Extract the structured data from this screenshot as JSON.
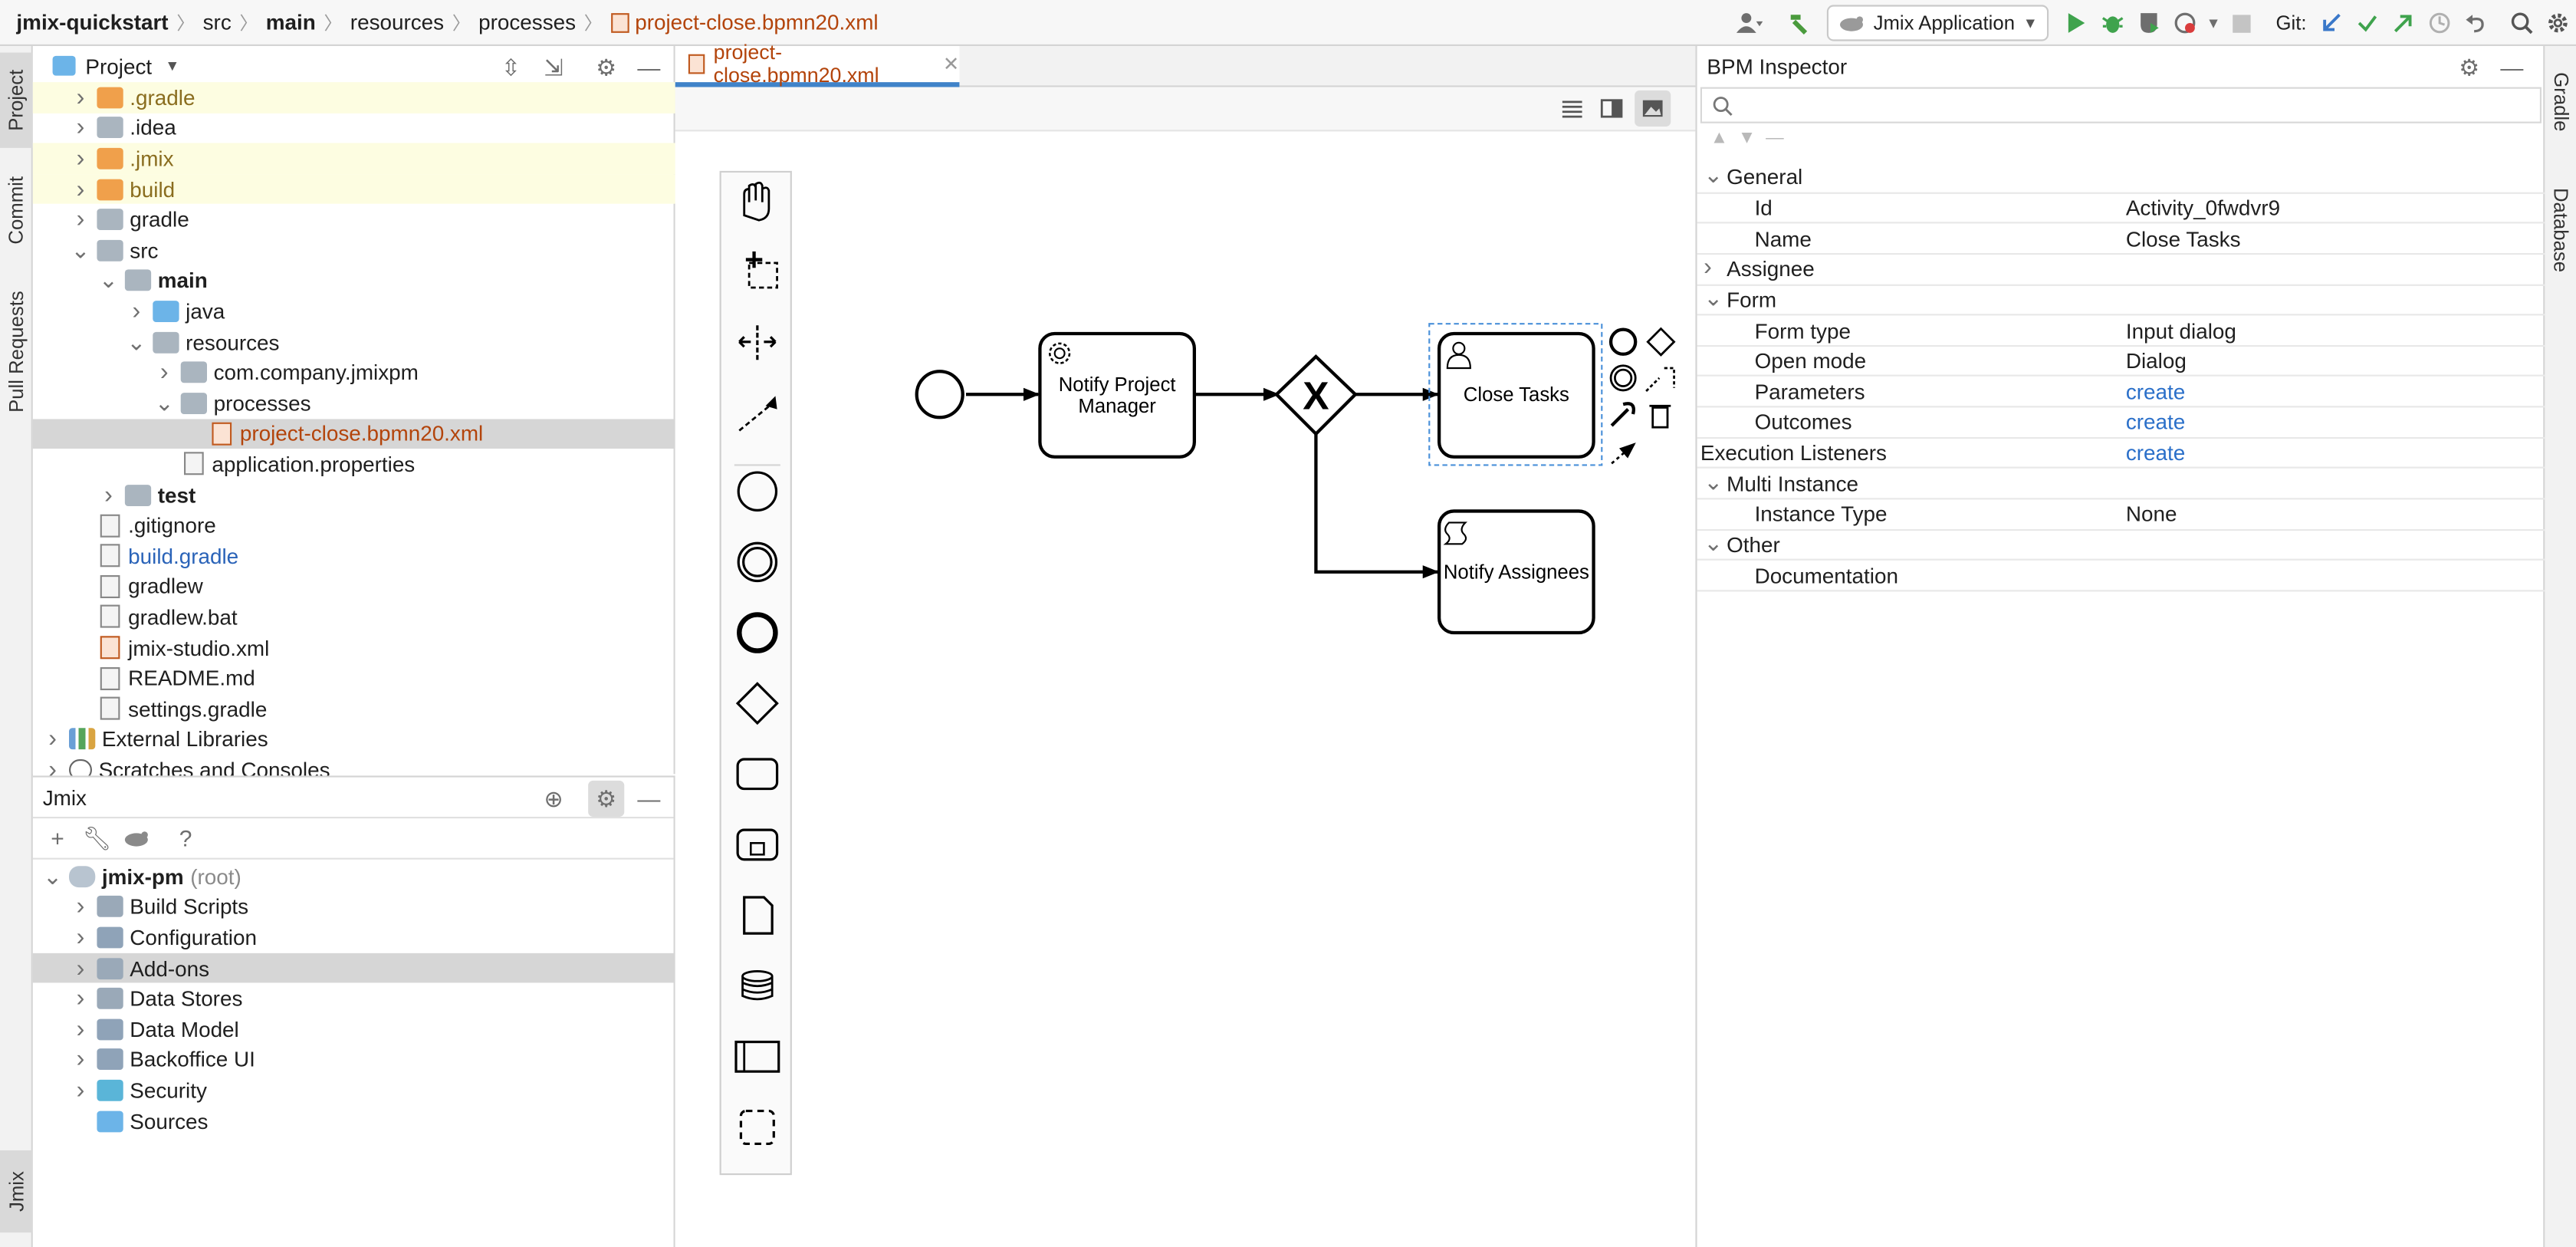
{
  "breadcrumb": {
    "project": "jmix-quickstart",
    "parts": [
      "src",
      "main",
      "resources",
      "processes"
    ],
    "file": "project-close.bpmn20.xml"
  },
  "toolbar": {
    "run_config": "Jmix Application",
    "git_label": "Git:"
  },
  "left_stripe": {
    "project": "Project",
    "commit": "Commit",
    "pull_requests": "Pull Requests",
    "jmix": "Jmix"
  },
  "right_stripe": {
    "gradle": "Gradle",
    "database": "Database"
  },
  "project_panel": {
    "title": "Project",
    "tree": [
      {
        "label": ".gradle",
        "depth": 1,
        "expand": ">",
        "icon": "folder-orange",
        "style": "hl"
      },
      {
        "label": ".idea",
        "depth": 1,
        "expand": ">",
        "icon": "folder",
        "style": ""
      },
      {
        "label": ".jmix",
        "depth": 1,
        "expand": ">",
        "icon": "folder-orange",
        "style": "hl"
      },
      {
        "label": "build",
        "depth": 1,
        "expand": ">",
        "icon": "folder-orange",
        "style": "hl"
      },
      {
        "label": "gradle",
        "depth": 1,
        "expand": ">",
        "icon": "folder",
        "style": ""
      },
      {
        "label": "src",
        "depth": 1,
        "expand": "v",
        "icon": "folder",
        "style": ""
      },
      {
        "label": "main",
        "depth": 2,
        "expand": "v",
        "icon": "folder",
        "style": "bold"
      },
      {
        "label": "java",
        "depth": 3,
        "expand": ">",
        "icon": "folder-blue",
        "style": ""
      },
      {
        "label": "resources",
        "depth": 3,
        "expand": "v",
        "icon": "folder",
        "style": ""
      },
      {
        "label": "com.company.jmixpm",
        "depth": 4,
        "expand": ">",
        "icon": "folder",
        "style": ""
      },
      {
        "label": "processes",
        "depth": 4,
        "expand": "v",
        "icon": "folder",
        "style": ""
      },
      {
        "label": "project-close.bpmn20.xml",
        "depth": 5,
        "expand": "",
        "icon": "file",
        "style": "sel"
      },
      {
        "label": "application.properties",
        "depth": 4,
        "expand": "",
        "icon": "file",
        "style": ""
      },
      {
        "label": "test",
        "depth": 2,
        "expand": ">",
        "icon": "folder",
        "style": "bold"
      },
      {
        "label": ".gitignore",
        "depth": 1,
        "expand": "",
        "icon": "file",
        "style": ""
      },
      {
        "label": "build.gradle",
        "depth": 1,
        "expand": "",
        "icon": "file",
        "style": "blue"
      },
      {
        "label": "gradlew",
        "depth": 1,
        "expand": "",
        "icon": "file",
        "style": ""
      },
      {
        "label": "gradlew.bat",
        "depth": 1,
        "expand": "",
        "icon": "file",
        "style": ""
      },
      {
        "label": "jmix-studio.xml",
        "depth": 1,
        "expand": "",
        "icon": "file",
        "style": ""
      },
      {
        "label": "README.md",
        "depth": 1,
        "expand": "",
        "icon": "file",
        "style": ""
      },
      {
        "label": "settings.gradle",
        "depth": 1,
        "expand": "",
        "icon": "file",
        "style": ""
      },
      {
        "label": "External Libraries",
        "depth": 0,
        "expand": ">",
        "icon": "library",
        "style": ""
      },
      {
        "label": "Scratches and Consoles",
        "depth": 0,
        "expand": ">",
        "icon": "scratch",
        "style": ""
      }
    ]
  },
  "jmix_panel": {
    "title": "Jmix",
    "root_name": "jmix-pm",
    "root_suffix": "(root)",
    "items": [
      {
        "label": "Build Scripts",
        "style": ""
      },
      {
        "label": "Configuration",
        "style": ""
      },
      {
        "label": "Add-ons",
        "style": "sel"
      },
      {
        "label": "Data Stores",
        "style": ""
      },
      {
        "label": "Data Model",
        "style": ""
      },
      {
        "label": "Backoffice UI",
        "style": ""
      },
      {
        "label": "Security",
        "style": ""
      },
      {
        "label": "Sources",
        "style": "noarrow"
      }
    ]
  },
  "editor": {
    "tab_label": "project-close.bpmn20.xml",
    "diagram": {
      "tasks": [
        {
          "label_1": "Notify Project",
          "label_2": "Manager",
          "kind": "service"
        },
        {
          "label_1": "Close Tasks",
          "label_2": "",
          "kind": "user"
        },
        {
          "label_1": "Notify Assignees",
          "label_2": "",
          "kind": "script"
        }
      ],
      "gateway_symbol": "X"
    }
  },
  "inspector": {
    "title": "BPM Inspector",
    "rows": [
      {
        "type": "group",
        "expand": "v",
        "key": "General",
        "value": ""
      },
      {
        "type": "prop",
        "expand": "",
        "key": "Id",
        "value": "Activity_0fwdvr9"
      },
      {
        "type": "prop",
        "expand": "",
        "key": "Name",
        "value": "Close Tasks"
      },
      {
        "type": "group",
        "expand": ">",
        "key": "Assignee",
        "value": ""
      },
      {
        "type": "group",
        "expand": "v",
        "key": "Form",
        "value": ""
      },
      {
        "type": "prop",
        "expand": "",
        "key": "Form type",
        "value": "Input dialog"
      },
      {
        "type": "prop",
        "expand": "",
        "key": "Open mode",
        "value": "Dialog"
      },
      {
        "type": "prop",
        "expand": "",
        "key": "Parameters",
        "value": "create",
        "link": true
      },
      {
        "type": "prop",
        "expand": "",
        "key": "Outcomes",
        "value": "create",
        "link": true
      },
      {
        "type": "top",
        "expand": "",
        "key": "Execution Listeners",
        "value": "create",
        "link": true
      },
      {
        "type": "group",
        "expand": "v",
        "key": "Multi Instance",
        "value": ""
      },
      {
        "type": "prop",
        "expand": "",
        "key": "Instance Type",
        "value": "None"
      },
      {
        "type": "group",
        "expand": "v",
        "key": "Other",
        "value": ""
      },
      {
        "type": "prop",
        "expand": "",
        "key": "Documentation",
        "value": ""
      }
    ]
  },
  "colors": {
    "file_orange": "#b3440b",
    "link_blue": "#2a6fc9",
    "selection": "#d6d6d6",
    "excluded": "#fdfde1",
    "accent": "#4083c9"
  }
}
